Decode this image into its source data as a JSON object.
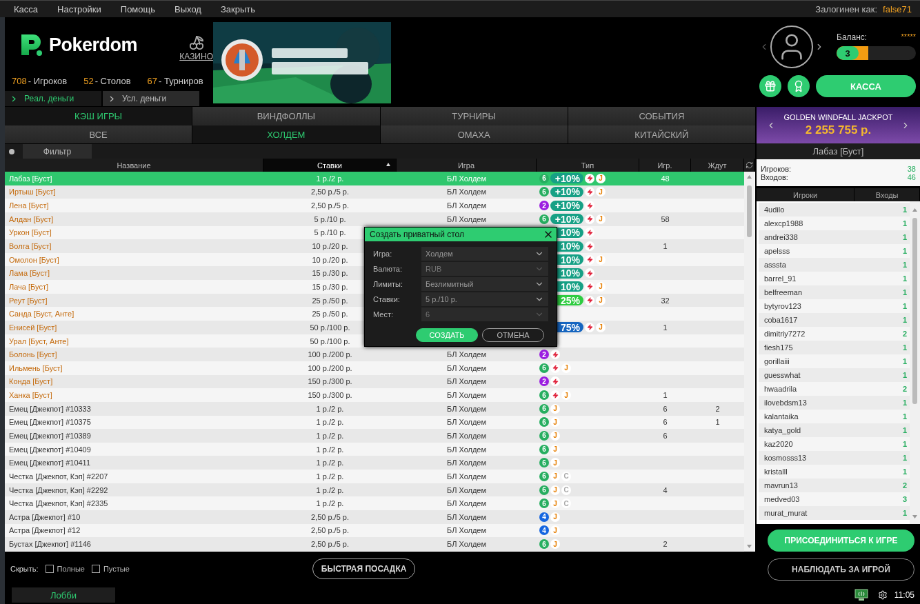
{
  "menu": {
    "items": [
      "Касса",
      "Настройки",
      "Помощь",
      "Выход",
      "Закрыть"
    ],
    "login_label": "Залогинен как:",
    "login_user": "false71"
  },
  "header": {
    "logo": "Pokerdom",
    "casino": "КАЗИНО",
    "stats": [
      {
        "count": "708",
        "caption": "- Игроков"
      },
      {
        "count": "52",
        "caption": "- Столов"
      },
      {
        "count": "67",
        "caption": "- Турниров"
      }
    ],
    "money_tabs": [
      {
        "label": "Реал. деньги",
        "selected": true
      },
      {
        "label": "Усл. деньги",
        "selected": false
      }
    ]
  },
  "profile": {
    "balance_label": "Баланс:",
    "balance_value": "*****",
    "level_badge": "3",
    "level": 0.4,
    "cashier": "КАССА"
  },
  "tabs": [
    {
      "label": "КЭШ ИГРЫ",
      "selected": true
    },
    {
      "label": "ВИНДФОЛЛЫ",
      "selected": false
    },
    {
      "label": "ТУРНИРЫ",
      "selected": false
    },
    {
      "label": "СОБЫТИЯ",
      "selected": false
    }
  ],
  "subtabs": [
    {
      "label": "ВСЕ",
      "selected": false
    },
    {
      "label": "ХОЛДЕМ",
      "selected": true
    },
    {
      "label": "ОМАХА",
      "selected": false
    },
    {
      "label": "КИТАЙСКИЙ",
      "selected": false
    }
  ],
  "filter": {
    "label": "Фильтр"
  },
  "table": {
    "columns": [
      {
        "label": "Название",
        "sorted": false
      },
      {
        "label": "Ставки",
        "sorted": true
      },
      {
        "label": "Игра",
        "sorted": false
      },
      {
        "label": "Тип",
        "sorted": false
      },
      {
        "label": "Игр.",
        "sorted": false
      },
      {
        "label": "Ждут",
        "sorted": false
      }
    ],
    "rows": [
      {
        "name": "Лабаз [Буст]",
        "kind": "boost",
        "selected": true,
        "stakes": "1 р./2 р.",
        "game": "БЛ Холдем",
        "seats": {
          "text": "6",
          "color": "#27ae60"
        },
        "bonus": {
          "text": "+10%",
          "color": "#16a085"
        },
        "fast": true,
        "marks": [
          {
            "text": "J",
            "color": "#e67e00"
          }
        ],
        "players": "48"
      },
      {
        "name": "Иртыш [Буст]",
        "kind": "boost",
        "selected": false,
        "stakes": "2,50 р./5 р.",
        "game": "БЛ Холдем",
        "seats": {
          "text": "6",
          "color": "#27ae60"
        },
        "bonus": {
          "text": "+10%",
          "color": "#16a085"
        },
        "fast": true,
        "marks": [
          {
            "text": "J",
            "color": "#e67e00"
          }
        ]
      },
      {
        "name": "Лена [Буст]",
        "kind": "boost",
        "selected": false,
        "stakes": "2,50 р./5 р.",
        "game": "БЛ Холдем",
        "seats": {
          "text": "2",
          "color": "#9b1ee0"
        },
        "bonus": {
          "text": "+10%",
          "color": "#16a085"
        },
        "fast": true
      },
      {
        "name": "Алдан [Буст]",
        "kind": "boost",
        "selected": false,
        "stakes": "5 р./10 р.",
        "game": "БЛ Холдем",
        "seats": {
          "text": "6",
          "color": "#27ae60"
        },
        "bonus": {
          "text": "+10%",
          "color": "#16a085"
        },
        "fast": true,
        "marks": [
          {
            "text": "J",
            "color": "#e67e00"
          }
        ],
        "players": "58"
      },
      {
        "name": "Уркон [Буст]",
        "kind": "boost",
        "selected": false,
        "stakes": "5 р./10 р.",
        "bonus": {
          "text": "10%",
          "color": "#16a085"
        },
        "fast": true
      },
      {
        "name": "Волга [Буст]",
        "kind": "boost",
        "selected": false,
        "stakes": "10 р./20 р.",
        "bonus": {
          "text": "10%",
          "color": "#16a085"
        },
        "fast": true,
        "players": "1"
      },
      {
        "name": "Омолон [Буст]",
        "kind": "boost",
        "selected": false,
        "stakes": "10 р./20 р.",
        "bonus": {
          "text": "10%",
          "color": "#16a085"
        },
        "fast": true,
        "marks": [
          {
            "text": "J",
            "color": "#e67e00"
          }
        ]
      },
      {
        "name": "Лама [Буст]",
        "kind": "boost",
        "selected": false,
        "stakes": "15 р./30 р.",
        "bonus": {
          "text": "10%",
          "color": "#16a085"
        },
        "fast": true
      },
      {
        "name": "Лача [Буст]",
        "kind": "boost",
        "selected": false,
        "stakes": "15 р./30 р.",
        "bonus": {
          "text": "10%",
          "color": "#16a085"
        },
        "fast": true,
        "marks": [
          {
            "text": "J",
            "color": "#e67e00"
          }
        ]
      },
      {
        "name": "Реут [Буст]",
        "kind": "boost",
        "selected": false,
        "stakes": "25 р./50 р.",
        "bonus": {
          "text": "25%",
          "color": "#2ecc40"
        },
        "fast": true,
        "marks": [
          {
            "text": "J",
            "color": "#e67e00"
          }
        ],
        "players": "32"
      },
      {
        "name": "Санда [Буст, Анте]",
        "kind": "boost",
        "selected": false,
        "stakes": "25 р./50 р."
      },
      {
        "name": "Енисей [Буст]",
        "kind": "boost",
        "selected": false,
        "stakes": "50 р./100 р.",
        "bonus": {
          "text": "75%",
          "color": "#1565c0"
        },
        "fast": true,
        "marks": [
          {
            "text": "J",
            "color": "#e67e00"
          }
        ],
        "players": "1"
      },
      {
        "name": "Урал [Буст, Анте]",
        "kind": "boost",
        "selected": false,
        "stakes": "50 р./100 р."
      },
      {
        "name": "Болонь [Буст]",
        "kind": "boost",
        "selected": false,
        "stakes": "100 р./200 р.",
        "game": "БЛ Холдем",
        "seats": {
          "text": "2",
          "color": "#9b1ee0"
        },
        "fast": true
      },
      {
        "name": "Ильмень [Буст]",
        "kind": "boost",
        "selected": false,
        "stakes": "100 р./200 р.",
        "game": "БЛ Холдем",
        "seats": {
          "text": "6",
          "color": "#27ae60"
        },
        "fast": true,
        "marks": [
          {
            "text": "J",
            "color": "#e67e00"
          }
        ]
      },
      {
        "name": "Конда [Буст]",
        "kind": "boost",
        "selected": false,
        "stakes": "150 р./300 р.",
        "game": "БЛ Холдем",
        "seats": {
          "text": "2",
          "color": "#9b1ee0"
        },
        "fast": true
      },
      {
        "name": "Ханка [Буст]",
        "kind": "boost",
        "selected": false,
        "stakes": "150 р./300 р.",
        "game": "БЛ Холдем",
        "seats": {
          "text": "6",
          "color": "#27ae60"
        },
        "fast": true,
        "marks": [
          {
            "text": "J",
            "color": "#e67e00"
          }
        ],
        "players": "1"
      },
      {
        "name": "Емец [Джекпот] #10333",
        "kind": "jackpot",
        "selected": false,
        "stakes": "1 р./2 р.",
        "game": "БЛ Холдем",
        "seats": {
          "text": "6",
          "color": "#27ae60"
        },
        "fast": false,
        "marks": [
          {
            "text": "J",
            "color": "#e67e00"
          }
        ],
        "players": "6",
        "waiting": "2"
      },
      {
        "name": "Емец [Джекпот] #10375",
        "kind": "jackpot",
        "selected": false,
        "stakes": "1 р./2 р.",
        "game": "БЛ Холдем",
        "seats": {
          "text": "6",
          "color": "#27ae60"
        },
        "fast": false,
        "marks": [
          {
            "text": "J",
            "color": "#e67e00"
          }
        ],
        "players": "6",
        "waiting": "1"
      },
      {
        "name": "Емец [Джекпот] #10389",
        "kind": "jackpot",
        "selected": false,
        "stakes": "1 р./2 р.",
        "game": "БЛ Холдем",
        "seats": {
          "text": "6",
          "color": "#27ae60"
        },
        "fast": false,
        "marks": [
          {
            "text": "J",
            "color": "#e67e00"
          }
        ],
        "players": "6"
      },
      {
        "name": "Емец [Джекпот] #10409",
        "kind": "jackpot",
        "selected": false,
        "stakes": "1 р./2 р.",
        "game": "БЛ Холдем",
        "seats": {
          "text": "6",
          "color": "#27ae60"
        },
        "fast": false,
        "marks": [
          {
            "text": "J",
            "color": "#e67e00"
          }
        ]
      },
      {
        "name": "Емец [Джекпот] #10411",
        "kind": "jackpot",
        "selected": false,
        "stakes": "1 р./2 р.",
        "game": "БЛ Холдем",
        "seats": {
          "text": "6",
          "color": "#27ae60"
        },
        "fast": false,
        "marks": [
          {
            "text": "J",
            "color": "#e67e00"
          }
        ]
      },
      {
        "name": "Честка [Джекпот, Кэп] #2207",
        "kind": "jackpot",
        "selected": false,
        "stakes": "1 р./2 р.",
        "game": "БЛ Холдем",
        "seats": {
          "text": "6",
          "color": "#27ae60"
        },
        "fast": false,
        "marks": [
          {
            "text": "J",
            "color": "#e67e00"
          },
          {
            "text": "C",
            "color": "#aaaaaa"
          }
        ]
      },
      {
        "name": "Честка [Джекпот, Кэп] #2292",
        "kind": "jackpot",
        "selected": false,
        "stakes": "1 р./2 р.",
        "game": "БЛ Холдем",
        "seats": {
          "text": "6",
          "color": "#27ae60"
        },
        "fast": false,
        "marks": [
          {
            "text": "J",
            "color": "#e67e00"
          },
          {
            "text": "C",
            "color": "#aaaaaa"
          }
        ],
        "players": "4"
      },
      {
        "name": "Честка [Джекпот, Кэп] #2335",
        "kind": "jackpot",
        "selected": false,
        "stakes": "1 р./2 р.",
        "game": "БЛ Холдем",
        "seats": {
          "text": "6",
          "color": "#27ae60"
        },
        "fast": false,
        "marks": [
          {
            "text": "J",
            "color": "#e67e00"
          },
          {
            "text": "C",
            "color": "#aaaaaa"
          }
        ]
      },
      {
        "name": "Астра [Джекпот] #10",
        "kind": "jackpot",
        "selected": false,
        "stakes": "2,50 р./5 р.",
        "game": "БЛ Холдем",
        "seats": {
          "text": "4",
          "color": "#1565e0"
        },
        "fast": false,
        "marks": [
          {
            "text": "J",
            "color": "#e67e00"
          }
        ]
      },
      {
        "name": "Астра [Джекпот] #12",
        "kind": "jackpot",
        "selected": false,
        "stakes": "2,50 р./5 р.",
        "game": "БЛ Холдем",
        "seats": {
          "text": "4",
          "color": "#1565e0"
        },
        "fast": false,
        "marks": [
          {
            "text": "J",
            "color": "#e67e00"
          }
        ]
      },
      {
        "name": "Бустах [Джекпот] #1146",
        "kind": "jackpot",
        "selected": false,
        "stakes": "2,50 р./5 р.",
        "game": "БЛ Холдем",
        "seats": {
          "text": "6",
          "color": "#27ae60"
        },
        "fast": false,
        "marks": [
          {
            "text": "J",
            "color": "#e67e00"
          }
        ],
        "players": "2"
      }
    ]
  },
  "dialog": {
    "title": "Создать приватный стол",
    "fields": [
      {
        "label": "Игра:",
        "value": "Холдем",
        "disabled": false
      },
      {
        "label": "Валюта:",
        "value": "RUB",
        "disabled": true
      },
      {
        "label": "Лимиты:",
        "value": "Безлимитный",
        "disabled": false
      },
      {
        "label": "Ставки:",
        "value": "5 р./10 р.",
        "disabled": false
      },
      {
        "label": "Мест:",
        "value": "6",
        "disabled": true
      }
    ],
    "buttons": [
      {
        "label": "СОЗДАТЬ",
        "kind": "primary"
      },
      {
        "label": "ОТМЕНА",
        "kind": "outline"
      }
    ]
  },
  "bottom": {
    "hide_label": "Скрыть:",
    "checkboxes": [
      {
        "label": "Полные",
        "checked": false
      },
      {
        "label": "Пустые",
        "checked": false
      }
    ],
    "quick_seat": "БЫСТРАЯ ПОСАДКА"
  },
  "jackpot": {
    "title": "GOLDEN WINDFALL JACKPOT",
    "amount": "2 255 755 р."
  },
  "table_info": {
    "title": "Лабаз [Буст]",
    "stats": [
      {
        "label": "Игроков:",
        "value": "38"
      },
      {
        "label": "Входов:",
        "value": "46"
      }
    ],
    "columns": [
      "Игроки",
      "Входы"
    ],
    "players": [
      {
        "name": "4udilo",
        "entries": "1"
      },
      {
        "name": "alexcp1988",
        "entries": "1"
      },
      {
        "name": "andrei338",
        "entries": "1"
      },
      {
        "name": "apelsss",
        "entries": "1"
      },
      {
        "name": "asssta",
        "entries": "1"
      },
      {
        "name": "barrel_91",
        "entries": "1"
      },
      {
        "name": "belfreeman",
        "entries": "1"
      },
      {
        "name": "bytyrov123",
        "entries": "1"
      },
      {
        "name": "coba1617",
        "entries": "1"
      },
      {
        "name": "dimitriy7272",
        "entries": "2"
      },
      {
        "name": "fiesh175",
        "entries": "1"
      },
      {
        "name": "gorillaiii",
        "entries": "1"
      },
      {
        "name": "guesswhat",
        "entries": "1"
      },
      {
        "name": "hwaadrila",
        "entries": "2"
      },
      {
        "name": "ilovebdsm13",
        "entries": "1"
      },
      {
        "name": "kalantaika",
        "entries": "1"
      },
      {
        "name": "katya_gold",
        "entries": "1"
      },
      {
        "name": "kaz2020",
        "entries": "1"
      },
      {
        "name": "kosmosss13",
        "entries": "1"
      },
      {
        "name": "kristalll",
        "entries": "1"
      },
      {
        "name": "mavrun13",
        "entries": "2"
      },
      {
        "name": "medved03",
        "entries": "3"
      },
      {
        "name": "murat_murat",
        "entries": "1"
      }
    ],
    "join": "ПРИСОЕДИНИТЬСЯ К ИГРЕ",
    "watch": "НАБЛЮДАТЬ ЗА ИГРОЙ"
  },
  "status_bar": {
    "lobby": "Лобби",
    "time": "11:05"
  }
}
